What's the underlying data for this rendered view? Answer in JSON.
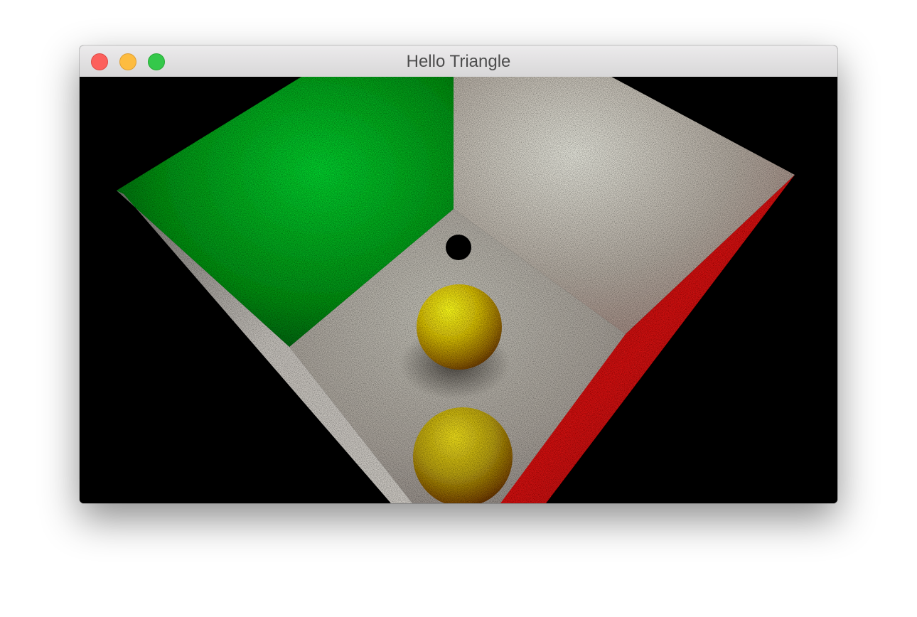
{
  "window": {
    "title": "Hello Triangle",
    "buttons": [
      "close",
      "minimize",
      "zoom"
    ]
  },
  "scene": {
    "background": "#000000",
    "left_wall_color": "#00c020",
    "right_wall_color": "#e0ded8",
    "side_wall_color": "#d01010",
    "floor_color": "#c8c4bc",
    "sphere_color": "#f2f000",
    "sphere_count": 2
  }
}
